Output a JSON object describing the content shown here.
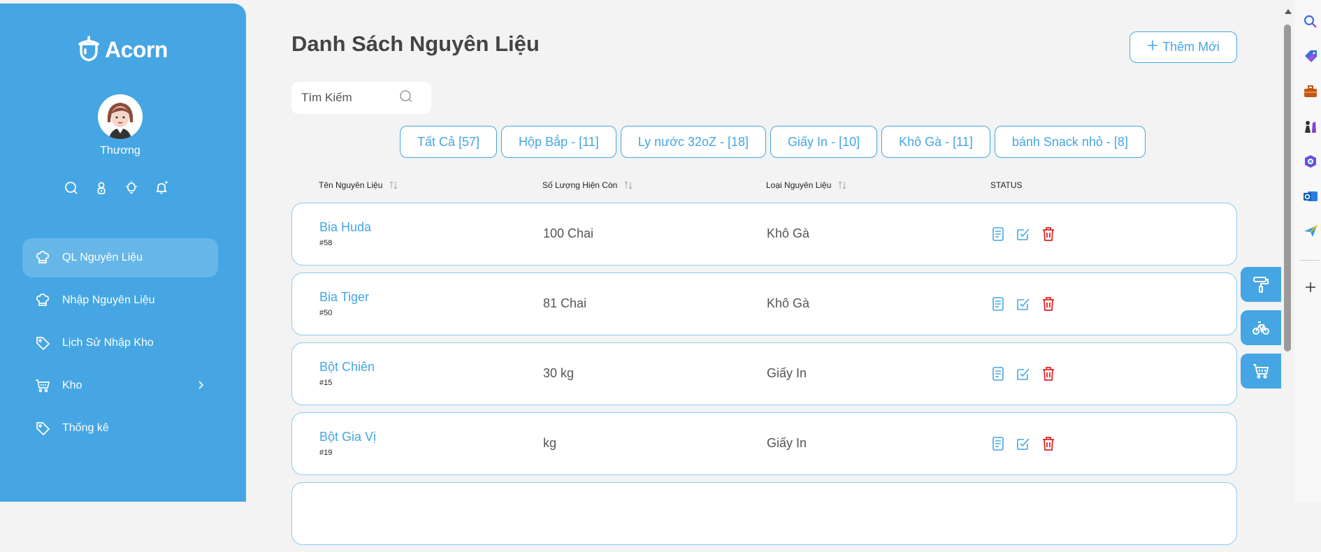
{
  "app": {
    "logo_text": "Acorn"
  },
  "user": {
    "name": "Thương"
  },
  "sidebar": {
    "items": [
      {
        "label": "QL Nguyên Liệu",
        "icon": "chef-hat-icon",
        "active": true
      },
      {
        "label": "Nhập Nguyên Liệu",
        "icon": "chef-hat-icon"
      },
      {
        "label": "Lịch Sử Nhập Kho",
        "icon": "tag-icon"
      },
      {
        "label": "Kho",
        "icon": "cart-icon"
      },
      {
        "label": "Thống kê",
        "icon": "tag-icon"
      }
    ]
  },
  "page": {
    "title": "Danh Sách Nguyên Liệu",
    "add_label": "Thêm Mới"
  },
  "search": {
    "placeholder": "Tìm Kiếm"
  },
  "filters": [
    "Tất Cả [57]",
    "Hộp Bắp - [11]",
    "Ly nước 32oZ - [18]",
    "Giấy In - [10]",
    "Khô Gà - [11]",
    "bánh Snack nhỏ - [8]"
  ],
  "table": {
    "headers": [
      "Tên Nguyên Liệu",
      "Số Lượng Hiện Còn",
      "Loại Nguyên Liệu",
      "STATUS"
    ],
    "rows": [
      {
        "name": "Bia Huda",
        "id": "#58",
        "qty": "100 Chai",
        "type": "Khô Gà"
      },
      {
        "name": "Bia Tiger",
        "id": "#50",
        "qty": "81 Chai",
        "type": "Khô Gà"
      },
      {
        "name": "Bột Chiên",
        "id": "#15",
        "qty": "30 kg",
        "type": "Giấy In"
      },
      {
        "name": "Bột Gia Vị",
        "id": "#19",
        "qty": "kg",
        "type": "Giấy In"
      }
    ]
  },
  "colors": {
    "primary": "#45a6e3",
    "danger": "#e02424",
    "background": "#f3f3f3"
  }
}
